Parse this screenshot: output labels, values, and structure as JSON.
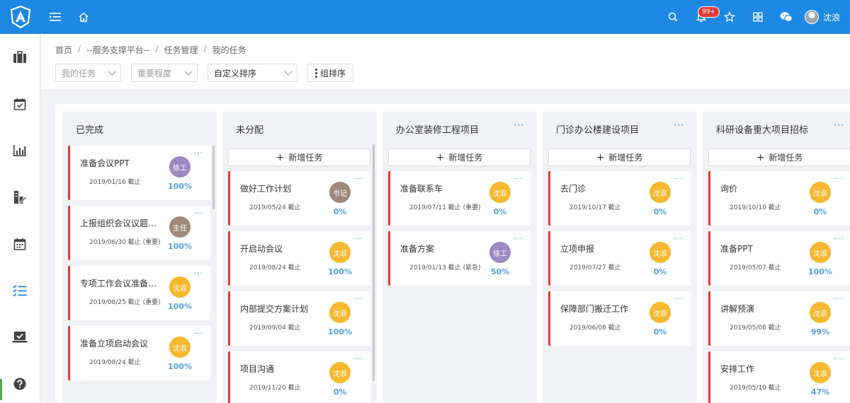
{
  "header": {
    "badge": "99+",
    "user_name": "沈浪"
  },
  "breadcrumb": [
    "首页",
    "--服务支撑平台--",
    "任务管理",
    "我的任务"
  ],
  "filters": {
    "my_tasks": "我的任务",
    "importance": "重要程度",
    "sort": "自定义排序",
    "group_sort": "组排序"
  },
  "board": {
    "add_label": "新增任务",
    "more": "···",
    "columns": [
      {
        "title": "已完成",
        "cards": [
          {
            "title": "准备会议PPT",
            "date": "2019/01/16 截止",
            "assignee": "徐工",
            "color": "#9b8ac4",
            "pct": "100%"
          },
          {
            "title": "上报组织会议议题及...",
            "date": "2019/06/30 截止 (重要)",
            "assignee": "主任",
            "color": "#a0887a",
            "pct": "100%"
          },
          {
            "title": "专项工作会议准备工作",
            "date": "2019/08/25 截止 (重要)",
            "assignee": "沈浪",
            "color": "#f5b82e",
            "pct": "100%"
          },
          {
            "title": "准备立项启动会议",
            "date": "2019/08/24 截止",
            "assignee": "沈浪",
            "color": "#f5b82e",
            "pct": "100%"
          }
        ]
      },
      {
        "title": "未分配",
        "cards": [
          {
            "title": "做好工作计划",
            "date": "2019/05/24 截止",
            "assignee": "书记",
            "color": "#a0887a",
            "pct": "0%"
          },
          {
            "title": "开启动会议",
            "date": "2019/08/24 截止",
            "assignee": "沈浪",
            "color": "#f5b82e",
            "pct": "100%"
          },
          {
            "title": "内部提交方案计划",
            "date": "2019/09/04 截止",
            "assignee": "沈浪",
            "color": "#f5b82e",
            "pct": "100%"
          },
          {
            "title": "项目沟通",
            "date": "2019/11/20 截止",
            "assignee": "沈浪",
            "color": "#f5b82e",
            "pct": "0%"
          }
        ]
      },
      {
        "title": "办公室装修工程项目",
        "cards": [
          {
            "title": "准备联系车",
            "date": "2019/07/11 截止 (重要)",
            "assignee": "沈浪",
            "color": "#f5b82e",
            "pct": "0%"
          },
          {
            "title": "准备方案",
            "date": "2019/01/13 截止 (紧急)",
            "assignee": "徐工",
            "color": "#9b8ac4",
            "pct": "50%"
          }
        ]
      },
      {
        "title": "门诊办公楼建设项目",
        "cards": [
          {
            "title": "去门诊",
            "date": "2019/10/17 截止",
            "assignee": "沈浪",
            "color": "#f5b82e",
            "pct": "0%"
          },
          {
            "title": "立项申报",
            "date": "2019/07/27 截止",
            "assignee": "沈浪",
            "color": "#f5b82e",
            "pct": "0%"
          },
          {
            "title": "保障部门搬迁工作",
            "date": "2019/06/08 截止",
            "assignee": "沈浪",
            "color": "#f5b82e",
            "pct": "0%"
          }
        ]
      },
      {
        "title": "科研设备重大项目招标",
        "cards": [
          {
            "title": "询价",
            "date": "2019/10/10 截止",
            "assignee": "沈浪",
            "color": "#f5b82e",
            "pct": "0%"
          },
          {
            "title": "准备PPT",
            "date": "2019/05/07 截止",
            "assignee": "沈浪",
            "color": "#f5b82e",
            "pct": "100%"
          },
          {
            "title": "讲解预演",
            "date": "2019/05/08 截止",
            "assignee": "沈浪",
            "color": "#f5b82e",
            "pct": "99%"
          },
          {
            "title": "安排工作",
            "date": "2019/05/10 截止",
            "assignee": "沈浪",
            "color": "#f5b82e",
            "pct": "47%"
          }
        ]
      }
    ]
  }
}
